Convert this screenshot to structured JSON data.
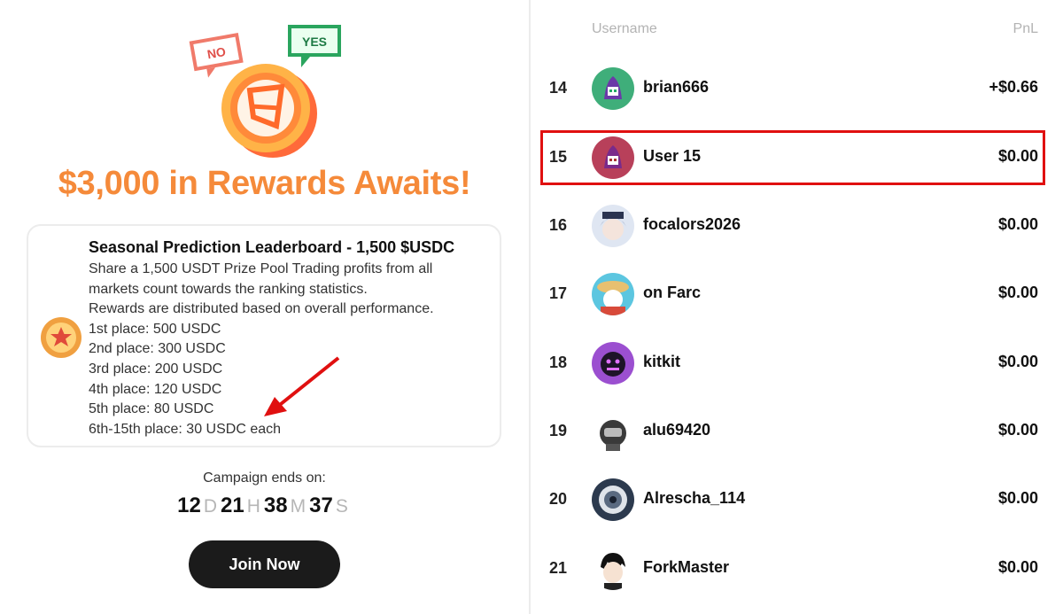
{
  "hero": {
    "bubble_no": "NO",
    "bubble_yes": "YES",
    "headline": "$3,000 in Rewards Awaits!"
  },
  "card": {
    "title": "Seasonal Prediction Leaderboard - 1,500 $USDC",
    "lines": [
      "Share a 1,500 USDT Prize Pool Trading profits from all",
      "markets count towards the ranking statistics.",
      "Rewards are distributed based on overall performance.",
      "1st place: 500 USDC",
      "2nd place: 300 USDC",
      "3rd place: 200 USDC",
      "4th place: 120 USDC",
      "5th place: 80 USDC",
      "6th-15th place: 30 USDC each"
    ]
  },
  "countdown": {
    "label": "Campaign ends on:",
    "days": "12",
    "days_unit": "D",
    "hours": "21",
    "hours_unit": "H",
    "minutes": "38",
    "minutes_unit": "M",
    "seconds": "37",
    "seconds_unit": "S"
  },
  "join_button": "Join Now",
  "leaderboard": {
    "col_username": "Username",
    "col_pnl": "PnL",
    "rows": [
      {
        "rank": "14",
        "name": "brian666",
        "pnl": "+$0.66"
      },
      {
        "rank": "15",
        "name": "User 15",
        "pnl": "$0.00"
      },
      {
        "rank": "16",
        "name": "focalors2026",
        "pnl": "$0.00"
      },
      {
        "rank": "17",
        "name": "on Farc",
        "pnl": "$0.00"
      },
      {
        "rank": "18",
        "name": "kitkit",
        "pnl": "$0.00"
      },
      {
        "rank": "19",
        "name": "alu69420",
        "pnl": "$0.00"
      },
      {
        "rank": "20",
        "name": "Alrescha_114",
        "pnl": "$0.00"
      },
      {
        "rank": "21",
        "name": "ForkMaster",
        "pnl": "$0.00"
      }
    ]
  },
  "colors": {
    "accent": "#f58a3a",
    "highlight": "#e01010",
    "button": "#1b1b1b",
    "unit_grey": "#b6b6b6"
  }
}
